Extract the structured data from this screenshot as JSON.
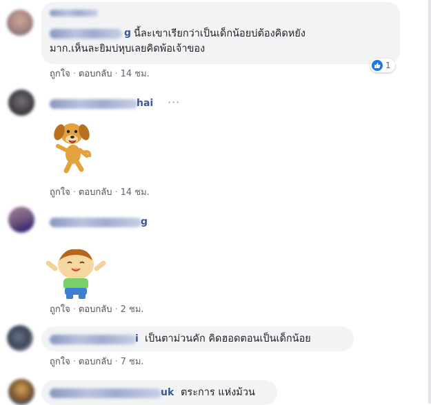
{
  "comments": [
    {
      "name_visible": "g",
      "text_line1": "นี้ละเขาเรียกว่าเป็นเด็กน้อยบ่ต้องคิดหยัง",
      "text_line2": "มาก.เห็นละยิมบ่หุบเลยคิดพ้อเจ้าของ",
      "like": "ถูกใจ",
      "reply": "ตอบกลับ",
      "time": "14 ชม.",
      "reaction_count": "1"
    },
    {
      "name_visible": "hai",
      "sticker": "dog-sticker",
      "like": "ถูกใจ",
      "reply": "ตอบกลับ",
      "time": "14 ชม.",
      "more": "···"
    },
    {
      "name_visible": "g",
      "sticker": "boy-sticker",
      "like": "ถูกใจ",
      "reply": "ตอบกลับ",
      "time": "2 ชม."
    },
    {
      "name_visible": "i",
      "text": "เป็นตาม่วนคัก คิดฮอดตอนเป็นเด็กน้อย",
      "like": "ถูกใจ",
      "reply": "ตอบกลับ",
      "time": "7 ชม."
    },
    {
      "name_visible": "uk",
      "text": "ตระการ แห่งม้วน"
    }
  ],
  "separator": "·",
  "colors": {
    "link": "#385898",
    "bubble": "#f2f3f5",
    "like": "#1877f2"
  }
}
